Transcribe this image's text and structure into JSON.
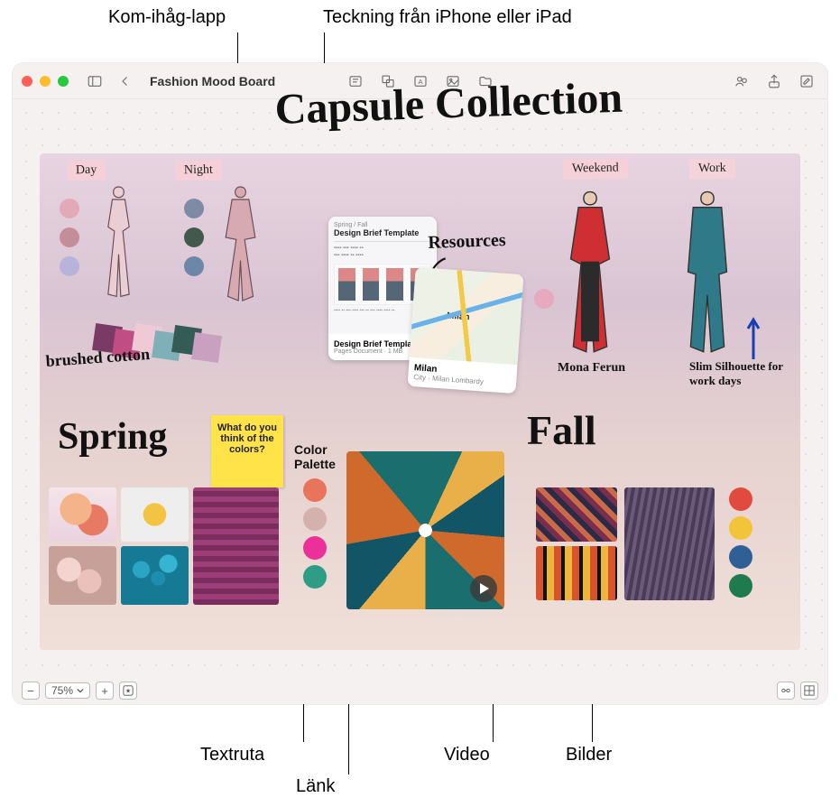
{
  "callouts": {
    "sticky": "Kom-ihåg-lapp",
    "sketch": "Teckning från iPhone eller iPad",
    "textbox": "Textruta",
    "link": "Länk",
    "video": "Video",
    "images": "Bilder"
  },
  "window": {
    "title": "Fashion Mood Board",
    "zoom": "75%"
  },
  "board": {
    "title_handwriting": "Capsule Collection",
    "spring": {
      "tag_day": "Day",
      "tag_night": "Night",
      "fabric_note": "brushed cotton",
      "season_label": "Spring"
    },
    "sticky_text": "What do you think of the colors?",
    "color_palette_label": "Color Palette",
    "palette_colors": [
      "#e9745c",
      "#d5b1ad",
      "#ec309a",
      "#2f9d86"
    ],
    "resources_label": "Resources",
    "doc_card": {
      "eyebrow": "Spring / Fall",
      "heading": "Design Brief Template",
      "title": "Design Brief Template",
      "subtitle": "Pages Document · 1 MB"
    },
    "map_card": {
      "map_label": "Milan",
      "title": "Milan",
      "subtitle": "City · Milan Lombardy"
    },
    "fall": {
      "tag_weekend": "Weekend",
      "tag_work": "Work",
      "season_label": "Fall",
      "note1": "Mona Ferun",
      "note2": "Slim Silhouette for work days",
      "palette_colors": [
        "#e14b3f",
        "#f2c43a",
        "#2f5f95",
        "#1f7a4d"
      ]
    }
  }
}
